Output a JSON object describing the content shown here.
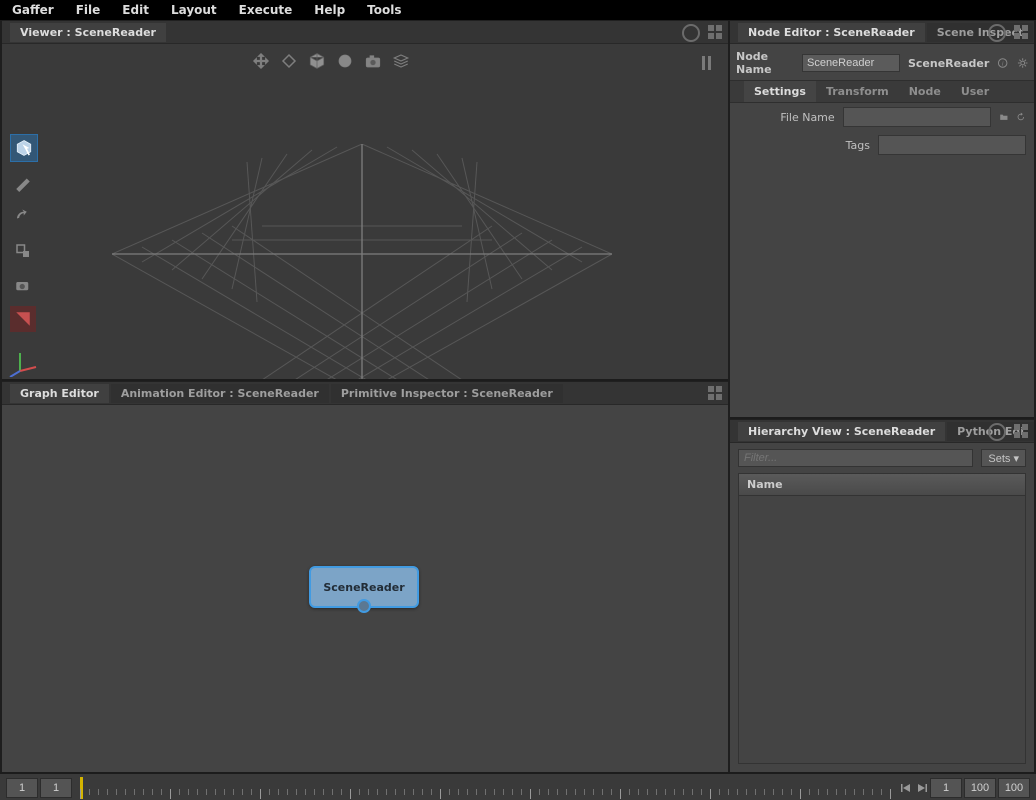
{
  "menubar": [
    "Gaffer",
    "File",
    "Edit",
    "Layout",
    "Execute",
    "Help",
    "Tools"
  ],
  "viewer": {
    "tab": "Viewer : SceneReader"
  },
  "graph": {
    "tabs": [
      "Graph Editor",
      "Animation Editor : SceneReader",
      "Primitive Inspector : SceneReader"
    ],
    "node_label": "SceneReader"
  },
  "node_editor": {
    "tabs": [
      "Node Editor : SceneReader",
      "Scene Inspect"
    ],
    "name_label": "Node Name",
    "name_value": "SceneReader",
    "type_name": "SceneReader",
    "subtabs": [
      "Settings",
      "Transform",
      "Node",
      "User"
    ],
    "fields": {
      "file_label": "File Name",
      "file_value": "",
      "tags_label": "Tags",
      "tags_value": ""
    }
  },
  "hierarchy": {
    "tabs": [
      "Hierarchy View : SceneReader",
      "Python Edi"
    ],
    "filter_placeholder": "Filter...",
    "sets_label": "Sets ▾",
    "column": "Name"
  },
  "timeline": {
    "start_cap": "1",
    "start": "1",
    "end": "100",
    "end_cap": "100",
    "current": "1"
  }
}
